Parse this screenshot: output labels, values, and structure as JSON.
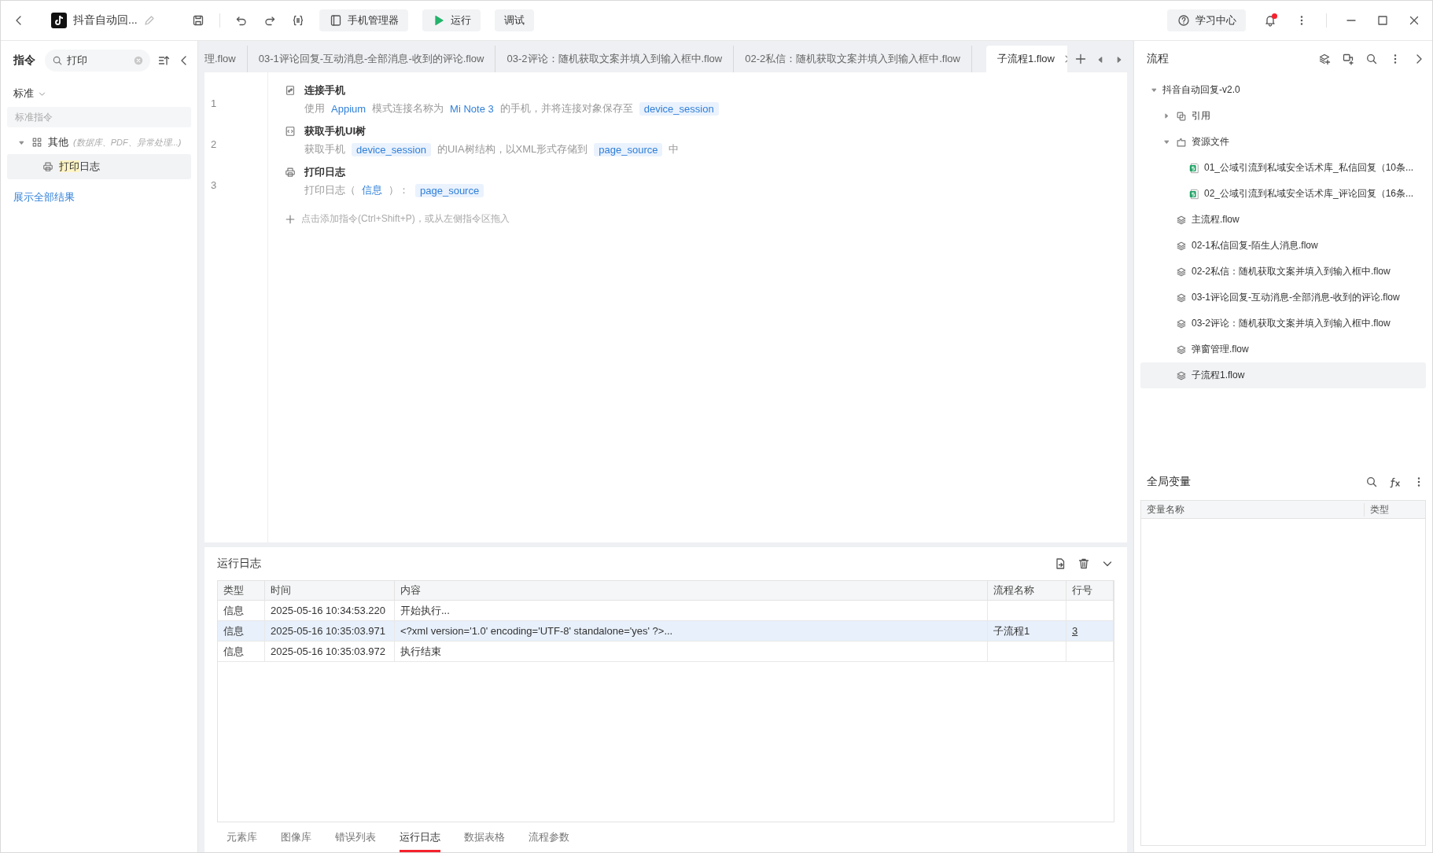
{
  "window": {
    "title": "抖音自动回...",
    "toolbar": [
      {
        "kind": "device",
        "label": "手机管理器"
      },
      {
        "kind": "run",
        "label": "运行"
      },
      {
        "kind": "plain",
        "label": "调试"
      }
    ],
    "help": "学习中心",
    "notification": {
      "unread": true
    }
  },
  "sidebar": {
    "title": "指令",
    "search": {
      "value": "打印"
    },
    "category": "标准",
    "section": "标准指令",
    "groups": [
      {
        "label": "其他",
        "hint": "(数据库、PDF、异常处理...)",
        "expanded": true,
        "items": [
          {
            "label_parts": [
              {
                "text": "打印",
                "highlighted": true
              },
              {
                "text": "日志",
                "highlighted": false
              }
            ],
            "selected": true
          }
        ]
      }
    ],
    "show_all": "展示全部结果"
  },
  "tabs": [
    {
      "label": "理.flow",
      "selected": false
    },
    {
      "label": "03-1评论回复-互动消息-全部消息-收到的评论.flow",
      "selected": false
    },
    {
      "label": "03-2评论：随机获取文案并填入到输入框中.flow",
      "selected": false
    },
    {
      "label": "02-2私信：随机获取文案并填入到输入框中.flow",
      "selected": false
    },
    {
      "label": "子流程1.flow",
      "selected": true
    }
  ],
  "steps": [
    {
      "line": "1",
      "kind": "connect",
      "title": "连接手机",
      "parts": [
        {
          "kind": "plain",
          "text": "使用"
        },
        {
          "kind": "value",
          "text": "Appium"
        },
        {
          "kind": "plain",
          "text": "模式连接名称为"
        },
        {
          "kind": "value",
          "text": "Mi Note 3"
        },
        {
          "kind": "plain",
          "text": "的手机，并将连接对象保存至"
        },
        {
          "kind": "var",
          "text": "device_session"
        }
      ]
    },
    {
      "line": "2",
      "kind": "code",
      "title": "获取手机UI树",
      "parts": [
        {
          "kind": "plain",
          "text": "获取手机"
        },
        {
          "kind": "var",
          "text": "device_session"
        },
        {
          "kind": "plain",
          "text": "的UIA树结构，以XML形式存储到"
        },
        {
          "kind": "var",
          "text": "page_source"
        },
        {
          "kind": "plain",
          "text": "中"
        }
      ]
    },
    {
      "line": "3",
      "kind": "print",
      "title": "打印日志",
      "parts": [
        {
          "kind": "plain",
          "text": "打印日志（"
        },
        {
          "kind": "value",
          "text": "信息"
        },
        {
          "kind": "plain",
          "text": "）："
        },
        {
          "kind": "var",
          "text": "page_source"
        }
      ]
    }
  ],
  "add_hint": "点击添加指令(Ctrl+Shift+P)，或从左侧指令区拖入",
  "log": {
    "title": "运行日志",
    "columns": [
      "类型",
      "时间",
      "内容",
      "流程名称",
      "行号"
    ],
    "rows": [
      {
        "selected": false,
        "cells": [
          "信息",
          "2025-05-16 10:34:53.220",
          "开始执行...",
          "",
          ""
        ]
      },
      {
        "selected": true,
        "cells": [
          "信息",
          "2025-05-16 10:35:03.971",
          "<?xml version='1.0' encoding='UTF-8' standalone='yes' ?>...",
          "子流程1",
          "3"
        ]
      },
      {
        "selected": false,
        "cells": [
          "信息",
          "2025-05-16 10:35:03.972",
          "执行结束",
          "",
          ""
        ]
      }
    ]
  },
  "bottom_tabs": [
    {
      "label": "元素库",
      "selected": false
    },
    {
      "label": "图像库",
      "selected": false
    },
    {
      "label": "错误列表",
      "selected": false
    },
    {
      "label": "运行日志",
      "selected": true
    },
    {
      "label": "数据表格",
      "selected": false
    },
    {
      "label": "流程参数",
      "selected": false
    }
  ],
  "flow_panel": {
    "title": "流程",
    "tree": [
      {
        "label": "抖音自动回复-v2.0",
        "expanded": true,
        "selected": false,
        "children": [
          {
            "kind": "ref",
            "label": "引用",
            "expanded": false,
            "selected": false
          },
          {
            "kind": "folder",
            "label": "资源文件",
            "expanded": true,
            "selected": false,
            "children": [
              {
                "kind": "sheet",
                "label": "01_公域引流到私域安全话术库_私信回复（10条...",
                "selected": false
              },
              {
                "kind": "sheet",
                "label": "02_公域引流到私域安全话术库_评论回复（16条...",
                "selected": false
              }
            ]
          },
          {
            "kind": "flow",
            "label": "主流程.flow",
            "selected": false
          },
          {
            "kind": "flow",
            "label": "02-1私信回复-陌生人消息.flow",
            "selected": false
          },
          {
            "kind": "flow",
            "label": "02-2私信：随机获取文案并填入到输入框中.flow",
            "selected": false
          },
          {
            "kind": "flow",
            "label": "03-1评论回复-互动消息-全部消息-收到的评论.flow",
            "selected": false
          },
          {
            "kind": "flow",
            "label": "03-2评论：随机获取文案并填入到输入框中.flow",
            "selected": false
          },
          {
            "kind": "flow",
            "label": "弹窗管理.flow",
            "selected": false
          },
          {
            "kind": "flow",
            "label": "子流程1.flow",
            "selected": true
          }
        ]
      }
    ]
  },
  "globals": {
    "title": "全局变量",
    "columns": [
      "变量名称",
      "类型"
    ]
  }
}
